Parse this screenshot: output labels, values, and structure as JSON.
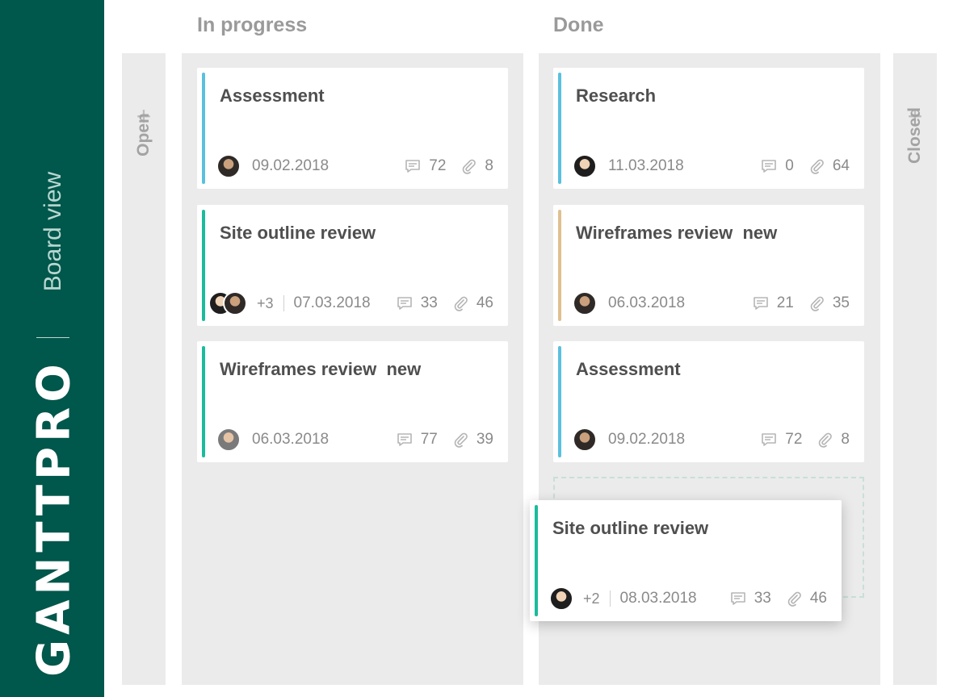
{
  "sidebar": {
    "brand": "GANTTPRO",
    "view_label": "Board view"
  },
  "columns": {
    "open": {
      "label": "Open",
      "add_icon": "plus-icon"
    },
    "in_progress": {
      "title": "In progress",
      "cards": [
        {
          "title": "Assessment",
          "date": "09.02.2018",
          "comments": "72",
          "attachments": "8",
          "extra_members": "",
          "accent": "#5bc0de"
        },
        {
          "title": "Site outline review",
          "date": "07.03.2018",
          "comments": "33",
          "attachments": "46",
          "extra_members": "+3",
          "accent": "#1abc9c"
        },
        {
          "title": "Wireframes review  new",
          "date": "06.03.2018",
          "comments": "77",
          "attachments": "39",
          "extra_members": "",
          "accent": "#1abc9c"
        }
      ]
    },
    "done": {
      "title": "Done",
      "cards": [
        {
          "title": "Research",
          "date": "11.03.2018",
          "comments": "0",
          "attachments": "64",
          "extra_members": "",
          "accent": "#5bc0de"
        },
        {
          "title": "Wireframes review  new",
          "date": "06.03.2018",
          "comments": "21",
          "attachments": "35",
          "extra_members": "",
          "accent": "#e0c090"
        },
        {
          "title": "Assessment",
          "date": "09.02.2018",
          "comments": "72",
          "attachments": "8",
          "extra_members": "",
          "accent": "#5bc0de"
        }
      ]
    },
    "closed": {
      "label": "Closed",
      "add_icon": "plus-icon"
    }
  },
  "dragging_card": {
    "title": "Site outline review",
    "date": "08.03.2018",
    "comments": "33",
    "attachments": "46",
    "extra_members": "+2",
    "accent": "#1abc9c"
  },
  "icons": {
    "comment": "comment-icon",
    "attachment": "paperclip-icon",
    "avatar": "avatar"
  }
}
